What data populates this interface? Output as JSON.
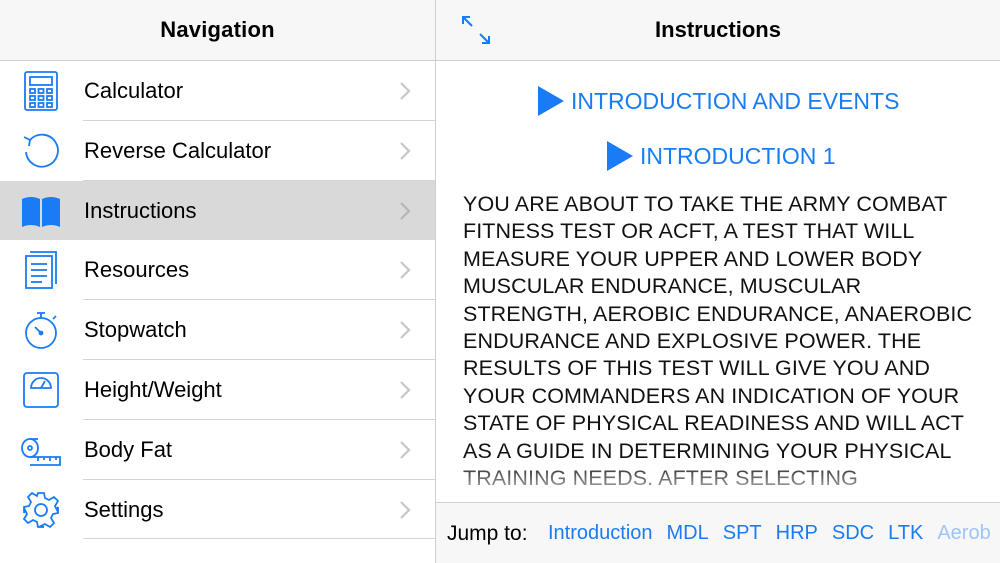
{
  "master": {
    "title": "Navigation",
    "items": [
      {
        "label": "Calculator",
        "icon": "calculator-icon",
        "selected": false
      },
      {
        "label": "Reverse Calculator",
        "icon": "reverse-arrow-icon",
        "selected": false
      },
      {
        "label": "Instructions",
        "icon": "book-icon",
        "selected": true
      },
      {
        "label": "Resources",
        "icon": "document-icon",
        "selected": false
      },
      {
        "label": "Stopwatch",
        "icon": "stopwatch-icon",
        "selected": false
      },
      {
        "label": "Height/Weight",
        "icon": "scale-icon",
        "selected": false
      },
      {
        "label": "Body Fat",
        "icon": "tape-measure-icon",
        "selected": false
      },
      {
        "label": "Settings",
        "icon": "gear-icon",
        "selected": false
      }
    ]
  },
  "detail": {
    "title": "Instructions",
    "sections": [
      {
        "label": "INTRODUCTION AND EVENTS"
      },
      {
        "label": "INTRODUCTION 1"
      }
    ],
    "body": "YOU ARE ABOUT TO TAKE THE ARMY COMBAT FITNESS TEST OR ACFT, A TEST THAT WILL MEASURE YOUR UPPER AND LOWER BODY MUSCULAR ENDURANCE, MUSCULAR STRENGTH, AEROBIC ENDURANCE, ANAEROBIC ENDURANCE AND EXPLOSIVE POWER. THE RESULTS OF THIS TEST WILL GIVE YOU AND YOUR COMMANDERS AN INDICATION OF YOUR STATE OF PHYSICAL READINESS AND WILL ACT AS A GUIDE IN DETERMINING YOUR PHYSICAL TRAINING NEEDS. AFTER SELECTING"
  },
  "jump": {
    "label": "Jump to:",
    "links": [
      "Introduction",
      "MDL",
      "SPT",
      "HRP",
      "SDC",
      "LTK",
      "Aerob"
    ]
  },
  "colors": {
    "accent": "#1a7cf5",
    "selected_row": "#d9d9d9",
    "bar_background": "#f7f7f7"
  }
}
